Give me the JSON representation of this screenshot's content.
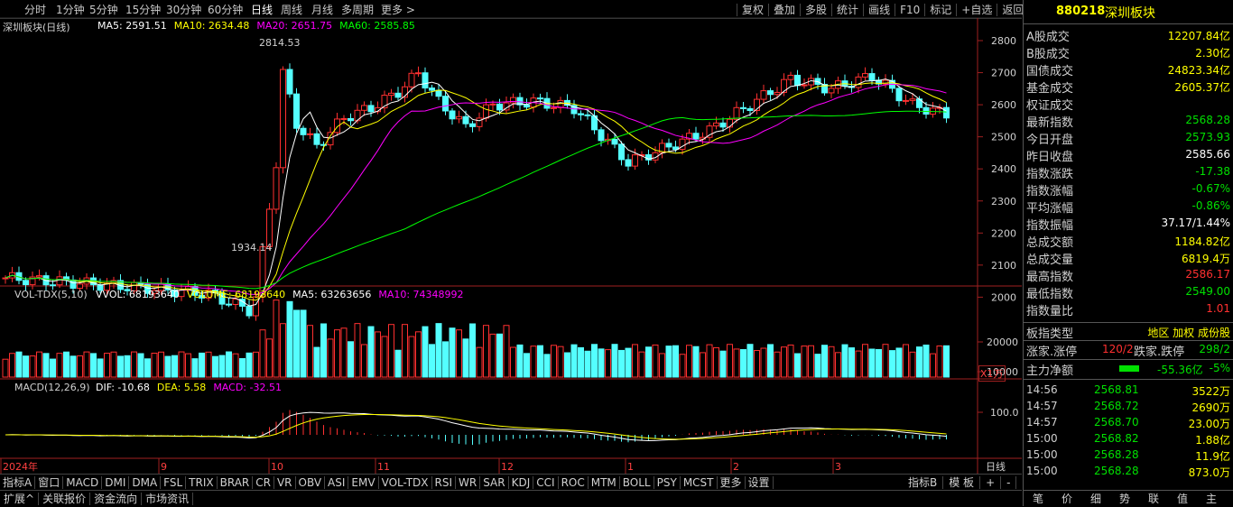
{
  "period_tabs": [
    "分时",
    "1分钟",
    "5分钟",
    "15分钟",
    "30分钟",
    "60分钟",
    "日线",
    "周线",
    "月线",
    "多周期",
    "更多 >"
  ],
  "toolbar_right": [
    "复权",
    "叠加",
    "多股",
    "统计",
    "画线",
    "F10",
    "标记",
    "+自选",
    "返回"
  ],
  "main_chart": {
    "label": "深圳板块(日线)",
    "ma": [
      {
        "name": "MA5",
        "text": "MA5: 2591.51",
        "color": "#ffffff"
      },
      {
        "name": "MA10",
        "text": "MA10: 2634.48",
        "color": "#ffff00"
      },
      {
        "name": "MA20",
        "text": "MA20: 2651.75",
        "color": "#ff00ff"
      },
      {
        "name": "MA60",
        "text": "MA60: 2585.85",
        "color": "#00ff00"
      }
    ],
    "yticks": [
      "2800",
      "2700",
      "2600",
      "2500",
      "2400",
      "2300",
      "2200",
      "2100",
      "2000"
    ],
    "high_label": "2814.53",
    "low_label": "1934.14"
  },
  "volume": {
    "label": "VOL-TDX(5,10)",
    "items": [
      {
        "text": "VVOL: 68193640",
        "color": "#ffffff"
      },
      {
        "text": "VOLUME: 68193640",
        "color": "#ffff00"
      },
      {
        "text": "MA5: 63263656",
        "color": "#ffffff"
      },
      {
        "text": "MA10: 74348992",
        "color": "#ff00ff"
      }
    ],
    "yticks": [
      "20000",
      "10000"
    ],
    "unit": "X1万"
  },
  "macd": {
    "label": "MACD(12,26,9)",
    "items": [
      {
        "text": "DIF: -10.68",
        "color": "#ffffff"
      },
      {
        "text": "DEA: 5.58",
        "color": "#ffff00"
      },
      {
        "text": "MACD: -32.51",
        "color": "#ff00ff"
      }
    ],
    "ytick": "100.0"
  },
  "time_axis": {
    "labels": [
      "2024年",
      "9",
      "10",
      "11",
      "12",
      "1",
      "2",
      "3"
    ],
    "right": "日线"
  },
  "indicator_tabs": [
    "指标A",
    "窗口",
    "MACD",
    "DMI",
    "DMA",
    "FSL",
    "TRIX",
    "BRAR",
    "CR",
    "VR",
    "OBV",
    "ASI",
    "EMV",
    "VOL-TDX",
    "RSI",
    "WR",
    "SAR",
    "KDJ",
    "CCI",
    "ROC",
    "MTM",
    "BOLL",
    "PSY",
    "MCST",
    "更多",
    "设置"
  ],
  "indicator_right": [
    "指标B",
    "模 板",
    "+",
    "-"
  ],
  "status_tabs": [
    "扩展^",
    "关联报价",
    "资金流向",
    "市场资讯"
  ],
  "panel": {
    "code": "880218",
    "name": "深圳板块",
    "rows": [
      {
        "k": "A股成交",
        "v": "12207.84亿",
        "c": "#ffff00"
      },
      {
        "k": "B股成交",
        "v": "2.30亿",
        "c": "#ffff00"
      },
      {
        "k": "国债成交",
        "v": "24823.34亿",
        "c": "#ffff00"
      },
      {
        "k": "基金成交",
        "v": "2605.37亿",
        "c": "#ffff00"
      },
      {
        "k": "权证成交",
        "v": "",
        "c": "#ffff00"
      },
      {
        "k": "最新指数",
        "v": "2568.28",
        "c": "#00e000"
      },
      {
        "k": "今日开盘",
        "v": "2573.93",
        "c": "#00e000"
      },
      {
        "k": "昨日收盘",
        "v": "2585.66",
        "c": "#ffffff"
      },
      {
        "k": "指数涨跌",
        "v": "-17.38",
        "c": "#00e000"
      },
      {
        "k": "指数涨幅",
        "v": "-0.67%",
        "c": "#00e000"
      },
      {
        "k": "平均涨幅",
        "v": "-0.86%",
        "c": "#00e000"
      },
      {
        "k": "指数振幅",
        "v": "37.17/1.44%",
        "c": "#ffffff"
      },
      {
        "k": "总成交额",
        "v": "1184.82亿",
        "c": "#ffff00"
      },
      {
        "k": "总成交量",
        "v": "6819.4万",
        "c": "#ffff00"
      },
      {
        "k": "最高指数",
        "v": "2586.17",
        "c": "#ff3030"
      },
      {
        "k": "最低指数",
        "v": "2549.00",
        "c": "#00e000"
      },
      {
        "k": "指数量比",
        "v": "1.01",
        "c": "#ff3030"
      }
    ],
    "board_type": {
      "k": "板指类型",
      "v": "地区 加权 成份股"
    },
    "limit_row": {
      "k1": "涨家.涨停",
      "v1": "120/2",
      "k2": "跌家.跌停",
      "v2": "298/2"
    },
    "capital_row": {
      "k": "主力净额",
      "v": "-55.36亿",
      "p": "-5%"
    },
    "ticks": [
      {
        "t": "14:56",
        "p": "2568.81",
        "v": "3522万"
      },
      {
        "t": "14:57",
        "p": "2568.72",
        "v": "2690万"
      },
      {
        "t": "14:57",
        "p": "2568.70",
        "v": "23.00万"
      },
      {
        "t": "15:00",
        "p": "2568.82",
        "v": "1.88亿"
      },
      {
        "t": "15:00",
        "p": "2568.28",
        "v": "11.9亿"
      },
      {
        "t": "15:00",
        "p": "2568.28",
        "v": "873.0万"
      }
    ],
    "tabs": [
      "笔",
      "价",
      "细",
      "势",
      "联",
      "值",
      "主"
    ]
  }
}
